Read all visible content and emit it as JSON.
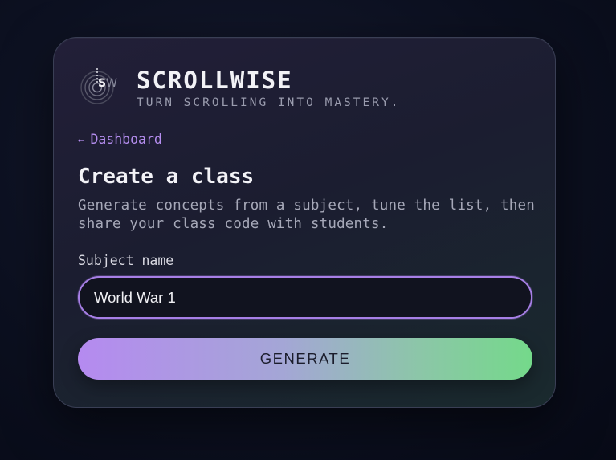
{
  "brand": {
    "title": "SCROLLWISE",
    "tagline": "TURN SCROLLING INTO MASTERY.",
    "logo_text": "SW",
    "logo_icon": "concentric-rings-icon"
  },
  "nav": {
    "back_arrow": "←",
    "back_label": "Dashboard",
    "back_icon": "arrow-left-icon"
  },
  "page": {
    "heading": "Create a class",
    "description": "Generate concepts from a subject, tune the list, then share your class code with students."
  },
  "form": {
    "subject_label": "Subject name",
    "subject_value": "World War 1",
    "generate_label": "GENERATE"
  },
  "colors": {
    "accent_purple": "#b58ef0",
    "accent_green": "#74d98a",
    "card_border": "#3a3f55",
    "input_border": "#a77fe6"
  }
}
